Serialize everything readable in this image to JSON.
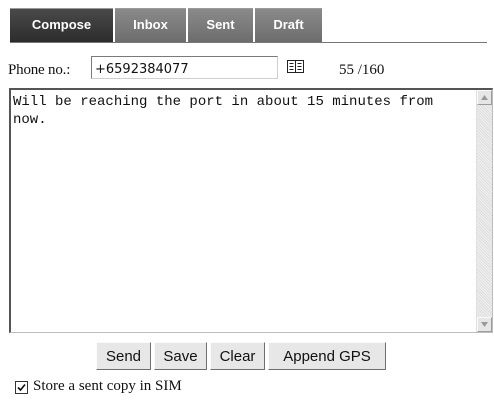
{
  "tabs": [
    {
      "label": "Compose",
      "active": true
    },
    {
      "label": "Inbox",
      "active": false
    },
    {
      "label": "Sent",
      "active": false
    },
    {
      "label": "Draft",
      "active": false
    }
  ],
  "phone": {
    "label": "Phone no.:",
    "value": "+6592384077",
    "contacts_icon": "address-book-icon"
  },
  "counter": "55 /160",
  "message": {
    "text": "Will be reaching the port in about 15 minutes from now."
  },
  "buttons": {
    "send": "Send",
    "save": "Save",
    "clear": "Clear",
    "append_gps": "Append GPS"
  },
  "store_copy": {
    "label": "Store a sent copy in SIM",
    "checked": true
  }
}
